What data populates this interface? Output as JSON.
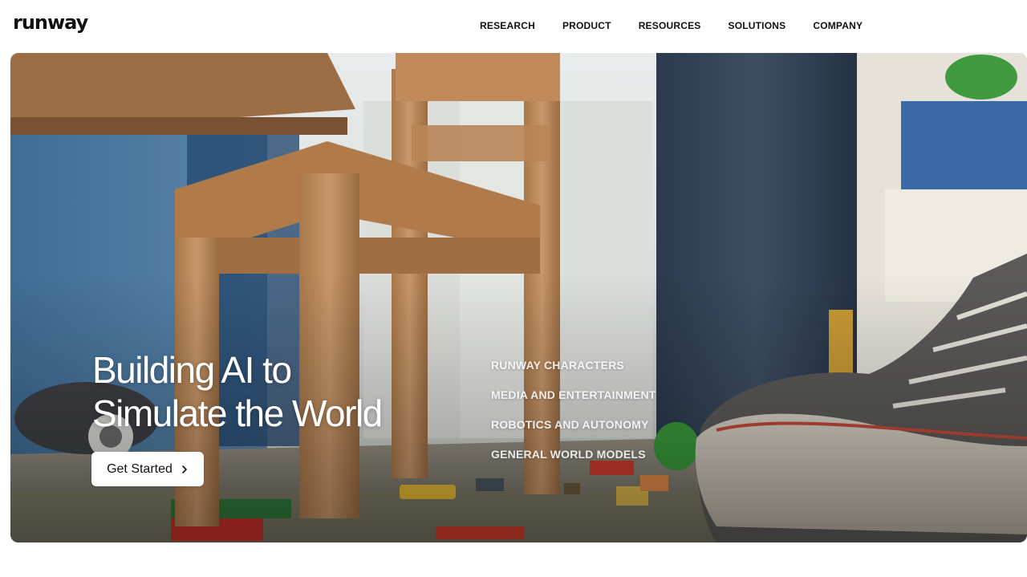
{
  "brand": {
    "logo_text": "runway"
  },
  "nav": {
    "items": [
      {
        "label": "RESEARCH"
      },
      {
        "label": "PRODUCT"
      },
      {
        "label": "RESOURCES"
      },
      {
        "label": "SOLUTIONS"
      },
      {
        "label": "COMPANY"
      }
    ]
  },
  "hero": {
    "headline_line1": "Building AI to",
    "headline_line2": "Simulate the World",
    "cta_label": "Get Started",
    "cta_icon": "chevron-right-icon",
    "topics": [
      {
        "label": "RUNWAY CHARACTERS"
      },
      {
        "label": "MEDIA AND ENTERTAINMENT"
      },
      {
        "label": "ROBOTICS AND AUTONOMY"
      },
      {
        "label": "GENERAL WORLD MODELS"
      }
    ],
    "background_image": "children's room with wooden chair, toy blocks and sneaker"
  },
  "colors": {
    "text_dark": "#111111",
    "hero_text": "#ffffff",
    "button_bg": "#ffffff",
    "page_bg": "#ffffff"
  }
}
